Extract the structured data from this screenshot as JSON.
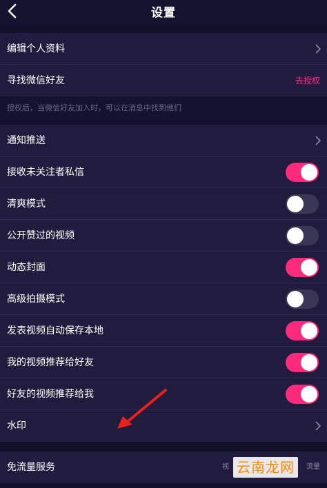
{
  "header": {
    "title": "设置",
    "back_icon": "chevron-left-icon"
  },
  "account": {
    "edit_profile": "编辑个人资料",
    "find_wechat_friends": "寻找微信好友",
    "authorize_link": "去授权",
    "hint": "授权后，当微信好友加入时，可以在消息中找到他们"
  },
  "settings": [
    {
      "label": "通知推送",
      "type": "nav"
    },
    {
      "label": "接收未关注者私信",
      "type": "toggle",
      "on": true
    },
    {
      "label": "清爽模式",
      "type": "toggle",
      "on": false
    },
    {
      "label": "公开赞过的视频",
      "type": "toggle",
      "on": false
    },
    {
      "label": "动态封面",
      "type": "toggle",
      "on": true
    },
    {
      "label": "高级拍摄模式",
      "type": "toggle",
      "on": false
    },
    {
      "label": "发表视频自动保存本地",
      "type": "toggle",
      "on": true
    },
    {
      "label": "我的视频推荐给好友",
      "type": "toggle",
      "on": true
    },
    {
      "label": "好友的视频推荐给我",
      "type": "toggle",
      "on": true
    },
    {
      "label": "水印",
      "type": "nav"
    }
  ],
  "traffic": {
    "label": "免流量服务",
    "right_text_start": "视",
    "right_text_end": "流量"
  },
  "overlay": {
    "watermark_text": "云南龙网",
    "arrow_color": "#e6221c"
  },
  "colors": {
    "accent": "#fe2b7d",
    "background": "#131029",
    "row_background": "#211c3e"
  }
}
